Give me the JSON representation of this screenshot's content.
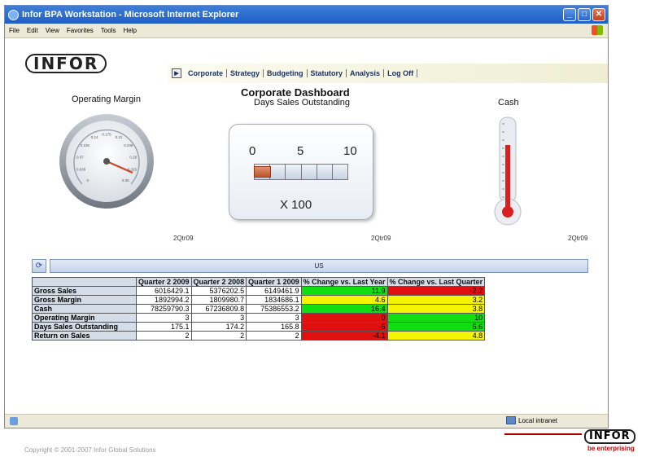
{
  "window": {
    "title": "Infor BPA Workstation - Microsoft Internet Explorer"
  },
  "menu": [
    "File",
    "Edit",
    "View",
    "Favorites",
    "Tools",
    "Help"
  ],
  "logo": "INFOR",
  "nav": {
    "tabs": [
      "Corporate",
      "Strategy",
      "Budgeting",
      "Statutory",
      "Analysis",
      "Log Off"
    ]
  },
  "dashboard": {
    "title": "Corporate Dashboard",
    "operating_margin": {
      "label": "Operating Margin",
      "ticks": [
        "0",
        "0.035",
        "0.07",
        "0.105",
        "0.14",
        "0.175",
        "0.21",
        "0.245",
        "0.28",
        "0.315",
        "0.35"
      ],
      "value": 3,
      "period": "2Qtr09"
    },
    "dso": {
      "label": "Days Sales Outstanding",
      "ticks": [
        "0",
        "5",
        "10"
      ],
      "multiplier": "X 100",
      "value_fraction": 0.18,
      "period": "2Qtr09"
    },
    "cash": {
      "label": "Cash",
      "period": "2Qtr09"
    }
  },
  "grid": {
    "refresh_icon": "refresh-icon",
    "region": "US",
    "columns": [
      "",
      "Quarter 2 2009",
      "Quarter 2 2008",
      "Quarter 1 2009",
      "% Change vs. Last Year",
      "% Change vs. Last Quarter"
    ],
    "rows": [
      {
        "label": "Gross Sales",
        "q2_2009": "6016429.1",
        "q2_2008": "5376202.5",
        "q1_2009": "6149461.9",
        "yoy": "11.9",
        "yoy_status": "green",
        "qoq": "-2.2",
        "qoq_status": "red"
      },
      {
        "label": "Gross Margin",
        "q2_2009": "1892994.2",
        "q2_2008": "1809980.7",
        "q1_2009": "1834686.1",
        "yoy": "4.6",
        "yoy_status": "yellow",
        "qoq": "3.2",
        "qoq_status": "yellow"
      },
      {
        "label": "Cash",
        "q2_2009": "78259790.3",
        "q2_2008": "67236809.8",
        "q1_2009": "75386553.2",
        "yoy": "16.4",
        "yoy_status": "green",
        "qoq": "3.8",
        "qoq_status": "yellow"
      },
      {
        "label": "Operating Margin",
        "q2_2009": "3",
        "q2_2008": "3",
        "q1_2009": "3",
        "yoy": "0",
        "yoy_status": "red",
        "qoq": "10",
        "qoq_status": "green"
      },
      {
        "label": "Days Sales Outstanding",
        "q2_2009": "175.1",
        "q2_2008": "174.2",
        "q1_2009": "165.8",
        "yoy": "-5",
        "yoy_status": "red",
        "qoq": "5.6",
        "qoq_status": "green"
      },
      {
        "label": "Return on Sales",
        "q2_2009": "2",
        "q2_2008": "2",
        "q1_2009": "2",
        "yoy": "-4.1",
        "yoy_status": "red",
        "qoq": "4.8",
        "qoq_status": "yellow"
      }
    ]
  },
  "status": {
    "zone": "Local intranet"
  },
  "footer": {
    "copyright": "Copyright © 2001-2007 Infor Global Solutions",
    "brand": "INFOR",
    "tagline": "be enterprising"
  },
  "colors": {
    "green": "#11dd11",
    "red": "#e01010",
    "yellow": "#f4f400",
    "accent": "#1f5fc4"
  }
}
